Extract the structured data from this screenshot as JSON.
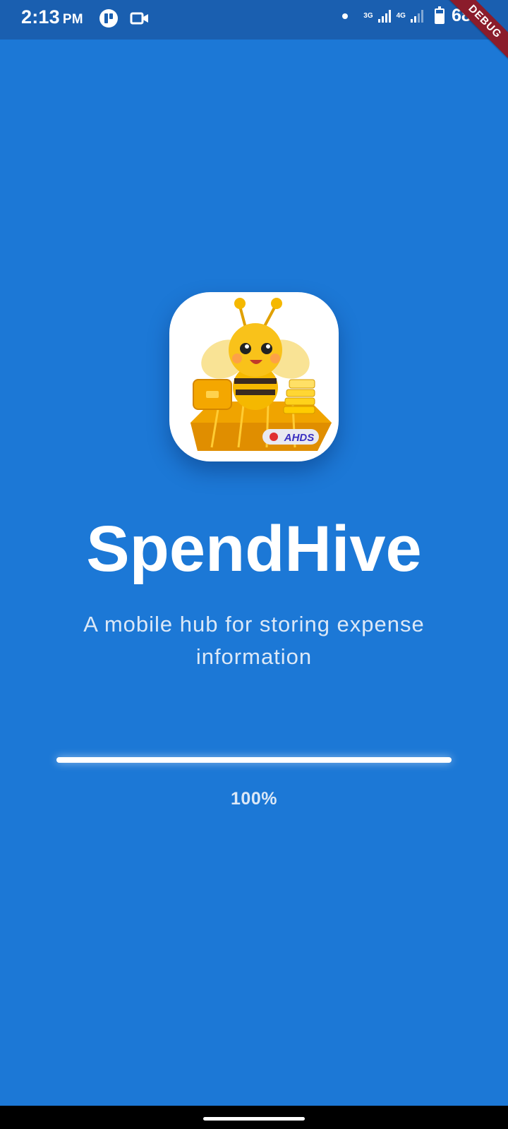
{
  "status_bar": {
    "time": "2:13",
    "ampm": "PM",
    "left_icons": [
      "notification-app-icon",
      "video-camera-icon"
    ],
    "network_1": "3G",
    "network_2": "4G",
    "battery_percent": "68%",
    "battery_level": 0.68
  },
  "debug_banner": "DEBUG",
  "splash": {
    "logo_label": "AHDS",
    "title": "SpendHive",
    "subtitle": "A mobile hub for storing expense information",
    "progress_fraction": 1.0,
    "progress_label": "100%"
  },
  "colors": {
    "background": "#1c78d6",
    "status_bar": "#1a5fb0",
    "debug_banner": "#8b1c2b"
  }
}
